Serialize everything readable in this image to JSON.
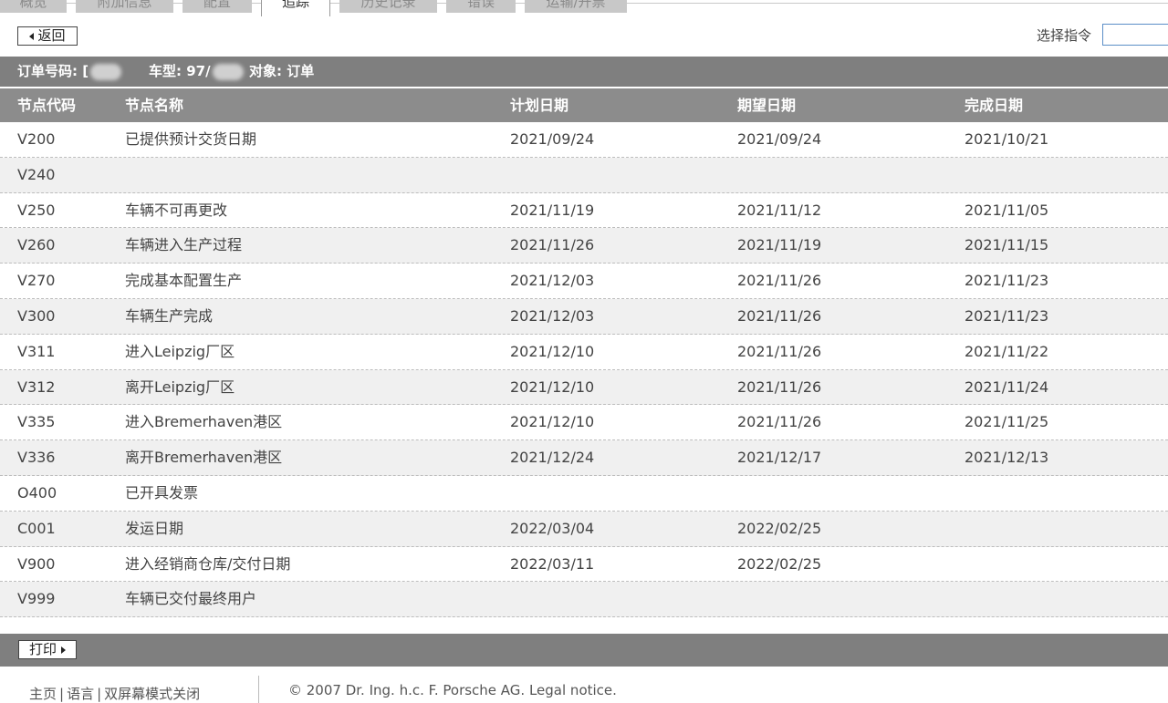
{
  "tabs": [
    "概览",
    "附加信息",
    "配置",
    "追踪",
    "历史记录",
    "错误",
    "运输/开票"
  ],
  "active_tab": 3,
  "toolbar": {
    "back_label": "返回",
    "command_label": "选择指令",
    "command_value": ""
  },
  "order": {
    "number_label": "订单号码: [",
    "model_label": "车型: 97/",
    "object_label": "对象: 订单"
  },
  "table": {
    "headers": [
      "节点代码",
      "节点名称",
      "计划日期",
      "期望日期",
      "完成日期"
    ],
    "rows": [
      [
        "V200",
        "已提供预计交货日期",
        "2021/09/24",
        "2021/09/24",
        "2021/10/21"
      ],
      [
        "V240",
        "",
        "",
        "",
        ""
      ],
      [
        "V250",
        "车辆不可再更改",
        "2021/11/19",
        "2021/11/12",
        "2021/11/05"
      ],
      [
        "V260",
        "车辆进入生产过程",
        "2021/11/26",
        "2021/11/19",
        "2021/11/15"
      ],
      [
        "V270",
        "完成基本配置生产",
        "2021/12/03",
        "2021/11/26",
        "2021/11/23"
      ],
      [
        "V300",
        "车辆生产完成",
        "2021/12/03",
        "2021/11/26",
        "2021/11/23"
      ],
      [
        "V311",
        "进入Leipzig厂区",
        "2021/12/10",
        "2021/11/26",
        "2021/11/22"
      ],
      [
        "V312",
        "离开Leipzig厂区",
        "2021/12/10",
        "2021/11/26",
        "2021/11/24"
      ],
      [
        "V335",
        "进入Bremerhaven港区",
        "2021/12/10",
        "2021/11/26",
        "2021/11/25"
      ],
      [
        "V336",
        "离开Bremerhaven港区",
        "2021/12/24",
        "2021/12/17",
        "2021/12/13"
      ],
      [
        "O400",
        "已开具发票",
        "",
        "",
        ""
      ],
      [
        "C001",
        "发运日期",
        "2022/03/04",
        "2022/02/25",
        ""
      ],
      [
        "V900",
        "进入经销商仓库/交付日期",
        "2022/03/11",
        "2022/02/25",
        ""
      ],
      [
        "V999",
        "车辆已交付最终用户",
        "",
        "",
        ""
      ]
    ]
  },
  "print_label": "打印",
  "footer": {
    "links": [
      "主页",
      "语言",
      "双屏幕模式关闭"
    ],
    "separator": "|",
    "copyright": "© 2007 Dr. Ing. h.c. F. Porsche AG. Legal notice."
  }
}
